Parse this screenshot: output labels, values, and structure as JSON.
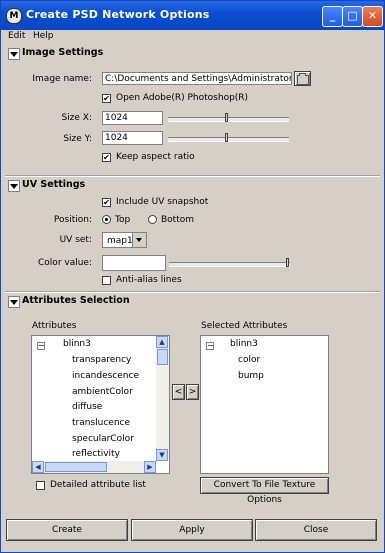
{
  "window": {
    "title": "Create PSD Network Options",
    "min_symbol": "_",
    "max_symbol": "□",
    "close_symbol": "✕"
  },
  "menu": [
    "Edit",
    "Help"
  ],
  "image_settings": {
    "header": "Image Settings",
    "image_name_label": "Image name:",
    "image_name_value": "C:\\Documents and Settings\\Administrator\\Desktop",
    "open_photoshop_label": "Open Adobe(R) Photoshop(R)",
    "open_photoshop_checked": true,
    "size_x_label": "Size X:",
    "size_x_value": "1024",
    "size_x_level": 0.49,
    "size_y_label": "Size Y:",
    "size_y_value": "1024",
    "size_y_level": 0.49,
    "keep_aspect_label": "Keep aspect ratio",
    "keep_aspect_checked": true
  },
  "uv_settings": {
    "header": "UV Settings",
    "include_uv_label": "Include UV snapshot",
    "include_uv_checked": true,
    "position_label": "Position:",
    "position_options": [
      "Top",
      "Bottom"
    ],
    "position_selected": "Top",
    "uv_set_label": "UV set:",
    "uv_set_value": "map1",
    "color_value_label": "Color value:",
    "color_value_level": 1.0,
    "antialias_label": "Anti-alias lines",
    "antialias_checked": false
  },
  "attributes_selection": {
    "header": "Attributes Selection",
    "attributes_label": "Attributes",
    "attributes_root": "blinn3",
    "attributes_items": [
      "transparency",
      "incandescence",
      "ambientColor",
      "diffuse",
      "translucence",
      "specularColor",
      "reflectivity"
    ],
    "selected_label": "Selected Attributes",
    "selected_root": "blinn3",
    "selected_items": [
      "color",
      "bump"
    ],
    "move_left": "<",
    "move_right": ">",
    "detailed_list_label": "Detailed attribute list",
    "detailed_list_checked": false,
    "convert_button": "Convert To File Texture Options"
  },
  "footer": {
    "create": "Create",
    "apply": "Apply",
    "close": "Close"
  },
  "colors": {
    "titlebar": "#0b4fd1",
    "panel": "#d4d0c8",
    "close_button": "#d24a24"
  }
}
